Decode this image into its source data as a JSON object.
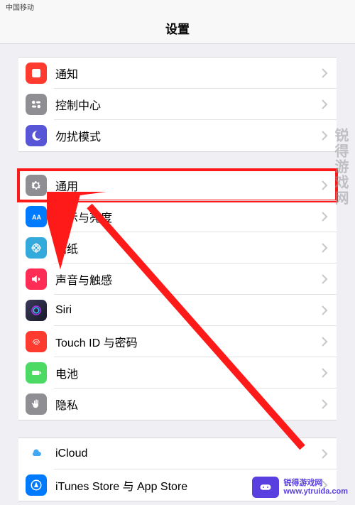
{
  "statusbar": {
    "carrier": "中国移动"
  },
  "navbar": {
    "title": "设置"
  },
  "groups": [
    {
      "items": [
        {
          "key": "notifications",
          "label": "通知"
        },
        {
          "key": "control-center",
          "label": "控制中心"
        },
        {
          "key": "dnd",
          "label": "勿扰模式"
        }
      ]
    },
    {
      "items": [
        {
          "key": "general",
          "label": "通用",
          "highlighted": true
        },
        {
          "key": "display",
          "label": "显示与亮度"
        },
        {
          "key": "wallpaper",
          "label": "墙纸"
        },
        {
          "key": "sounds",
          "label": "声音与触感"
        },
        {
          "key": "siri",
          "label": "Siri"
        },
        {
          "key": "touchid",
          "label": "Touch ID 与密码"
        },
        {
          "key": "battery",
          "label": "电池"
        },
        {
          "key": "privacy",
          "label": "隐私"
        }
      ]
    },
    {
      "items": [
        {
          "key": "icloud",
          "label": "iCloud"
        },
        {
          "key": "itunes",
          "label": "iTunes Store 与 App Store"
        }
      ]
    }
  ],
  "watermark": {
    "text": "锐得游戏网",
    "url": "www.ytruida.com"
  },
  "footer": {
    "brand": "锐得游戏网",
    "url": "www.ytruida.com"
  },
  "colors": {
    "highlight": "#ff1a1a",
    "arrow": "#ff1a1a"
  }
}
